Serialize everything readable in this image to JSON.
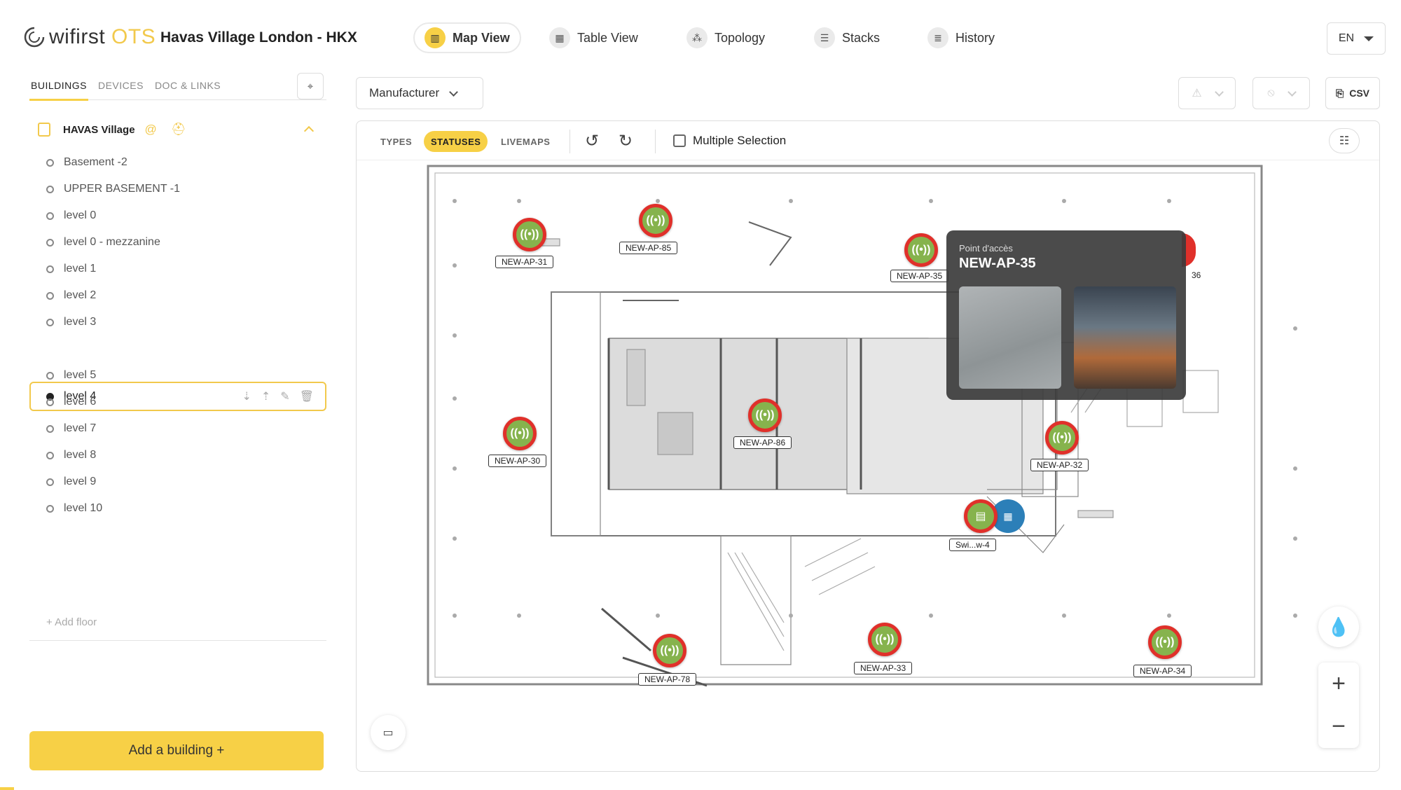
{
  "app": {
    "logo_word": "wifirst",
    "logo_suffix": "OTS",
    "site_title": "Havas Village London - HKX",
    "lang": "EN"
  },
  "nav": [
    {
      "label": "Map View",
      "icon": "map-icon",
      "active": true
    },
    {
      "label": "Table View",
      "icon": "table-icon",
      "active": false
    },
    {
      "label": "Topology",
      "icon": "topology-icon",
      "active": false
    },
    {
      "label": "Stacks",
      "icon": "stacks-icon",
      "active": false
    },
    {
      "label": "History",
      "icon": "history-icon",
      "active": false
    }
  ],
  "sidebar": {
    "tabs": [
      "BUILDINGS",
      "DEVICES",
      "DOC & LINKS"
    ],
    "active_tab": "BUILDINGS",
    "building": "HAVAS Village",
    "floors": [
      "Basement -2",
      "UPPER BASEMENT -1",
      "level 0",
      "level 0 - mezzanine",
      "level 1",
      "level 2",
      "level 3",
      "level 4",
      "level 5",
      "level 6",
      "level 7",
      "level 8",
      "level 9",
      "level 10"
    ],
    "selected_floor": "level 4",
    "add_floor": "+ Add floor",
    "add_building": "Add a building +"
  },
  "filters": {
    "manufacturer": "Manufacturer",
    "csv": "CSV"
  },
  "map_toolbar": {
    "tabs": [
      "TYPES",
      "STATUSES",
      "LIVEMAPS"
    ],
    "active_tab": "STATUSES",
    "multiple_selection": "Multiple Selection"
  },
  "access_points": [
    {
      "name": "NEW-AP-31"
    },
    {
      "name": "NEW-AP-85"
    },
    {
      "name": "NEW-AP-35"
    },
    {
      "name": "NEW-AP-30"
    },
    {
      "name": "NEW-AP-86"
    },
    {
      "name": "NEW-AP-32"
    },
    {
      "name": "NEW-AP-78"
    },
    {
      "name": "NEW-AP-33"
    },
    {
      "name": "NEW-AP-34"
    }
  ],
  "switch": {
    "name": "Swi...w-4"
  },
  "partial_label": "36",
  "popup": {
    "heading": "Point d'accès",
    "title": "NEW-AP-35"
  },
  "colors": {
    "accent": "#f7d046",
    "ap_ok": "#86b34d",
    "ap_ring": "#e0302a",
    "switch": "#2c7fb8"
  }
}
